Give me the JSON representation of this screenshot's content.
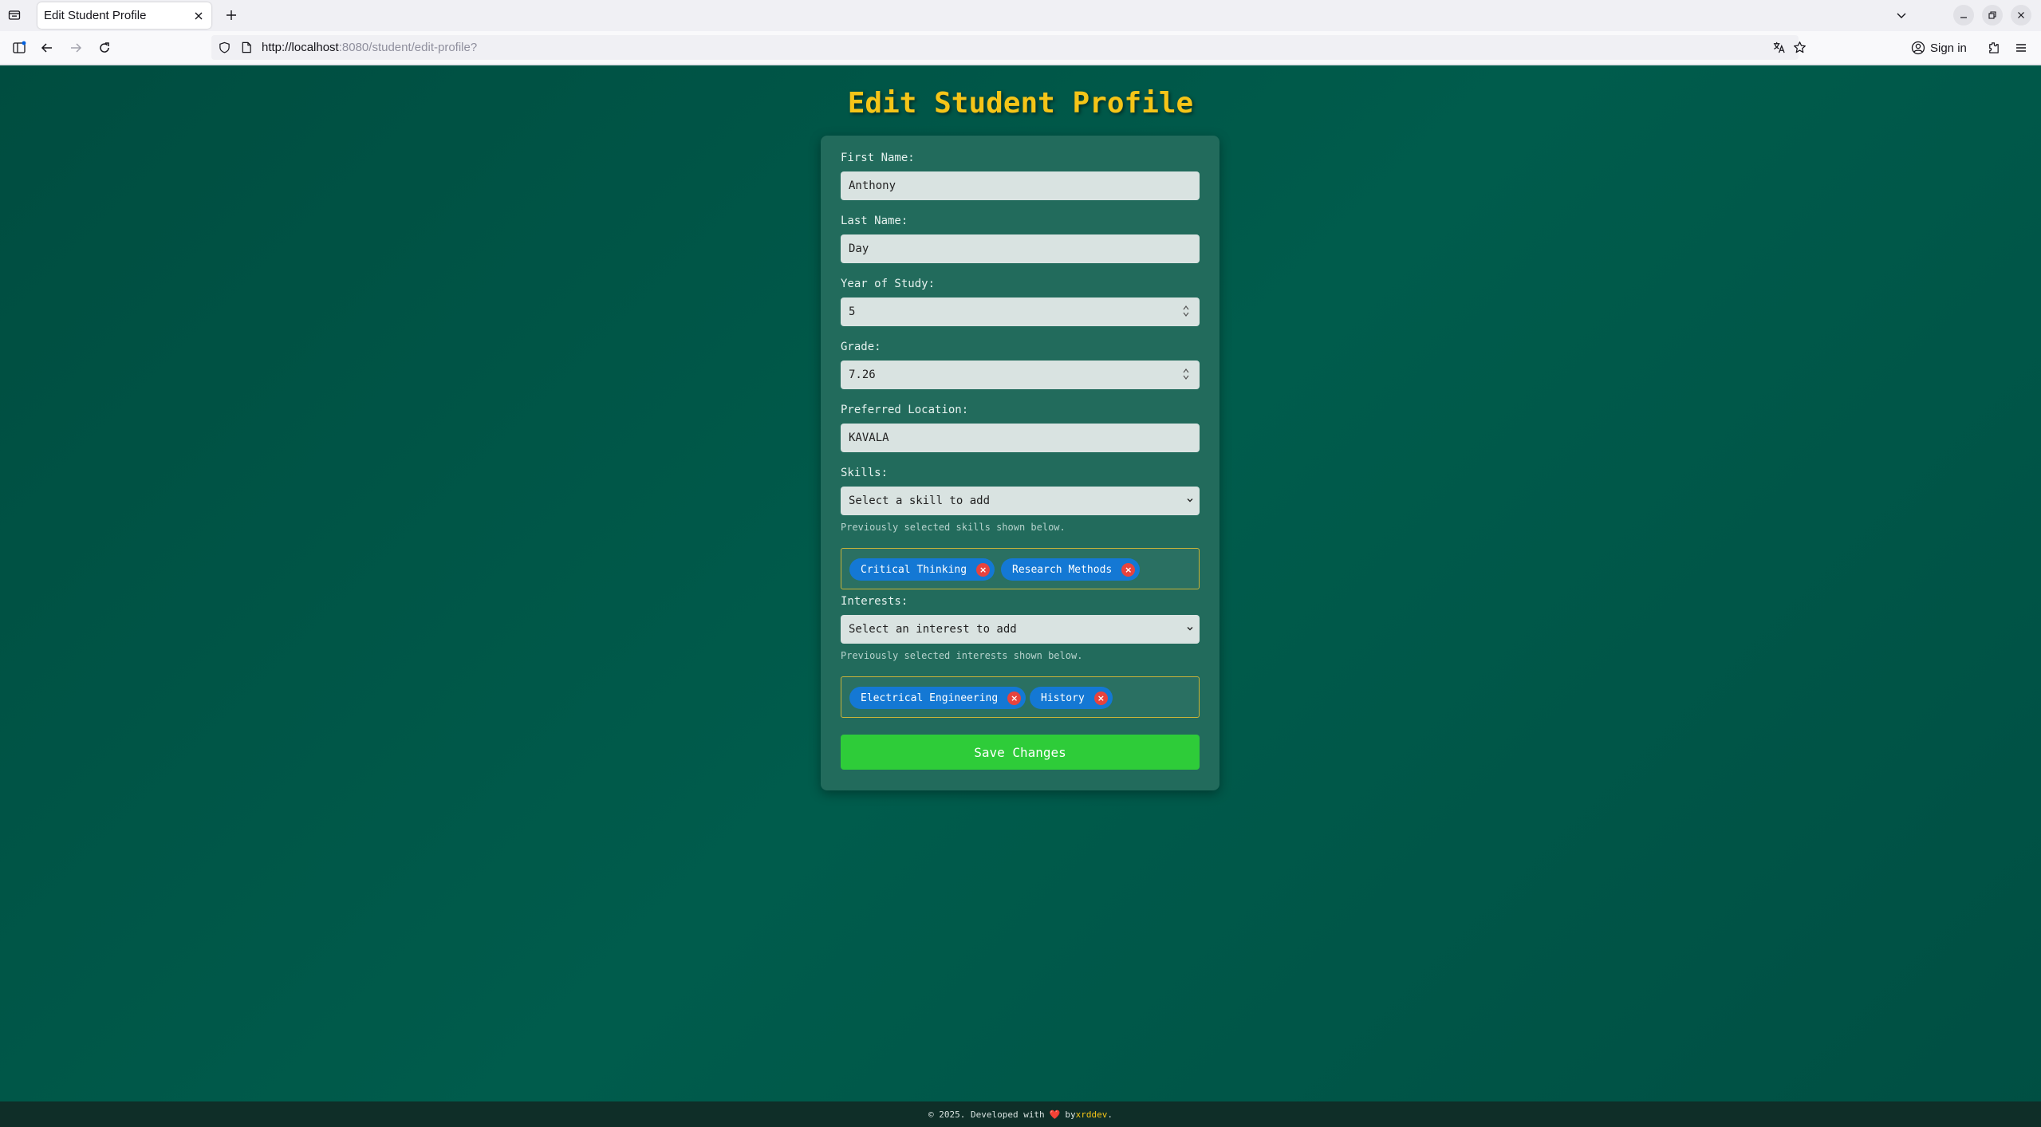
{
  "browser": {
    "tab_title": "Edit Student Profile",
    "url_scheme_host": "http://localhost",
    "url_rest": ":8080/student/edit-profile?",
    "sign_in_label": "Sign in"
  },
  "page": {
    "title": "Edit Student Profile"
  },
  "form": {
    "first_name_label": "First Name:",
    "first_name_value": "Anthony",
    "last_name_label": "Last Name:",
    "last_name_value": "Day",
    "year_label": "Year of Study:",
    "year_value": "5",
    "grade_label": "Grade:",
    "grade_value": "7.26",
    "location_label": "Preferred Location:",
    "location_value": "KAVALA",
    "skills_label": "Skills:",
    "skills_select": "Select a skill to add",
    "skills_hint": "Previously selected skills shown below.",
    "skills": [
      "Critical Thinking",
      "Research Methods"
    ],
    "interests_label": "Interests:",
    "interests_select": "Select an interest to add",
    "interests_hint": "Previously selected interests shown below.",
    "interests": [
      "Electrical Engineering",
      "History"
    ],
    "remove_symbol": "×",
    "save_label": "Save Changes"
  },
  "footer": {
    "prefix": "© 2025. Developed with",
    "heart": "❤️",
    "by": "by",
    "author": "xrddev",
    "suffix": "."
  },
  "colors": {
    "title": "#f5c518",
    "card": "#226b5c",
    "tag": "#1478d4",
    "remove": "#e8433e",
    "save": "#2ecc39"
  }
}
